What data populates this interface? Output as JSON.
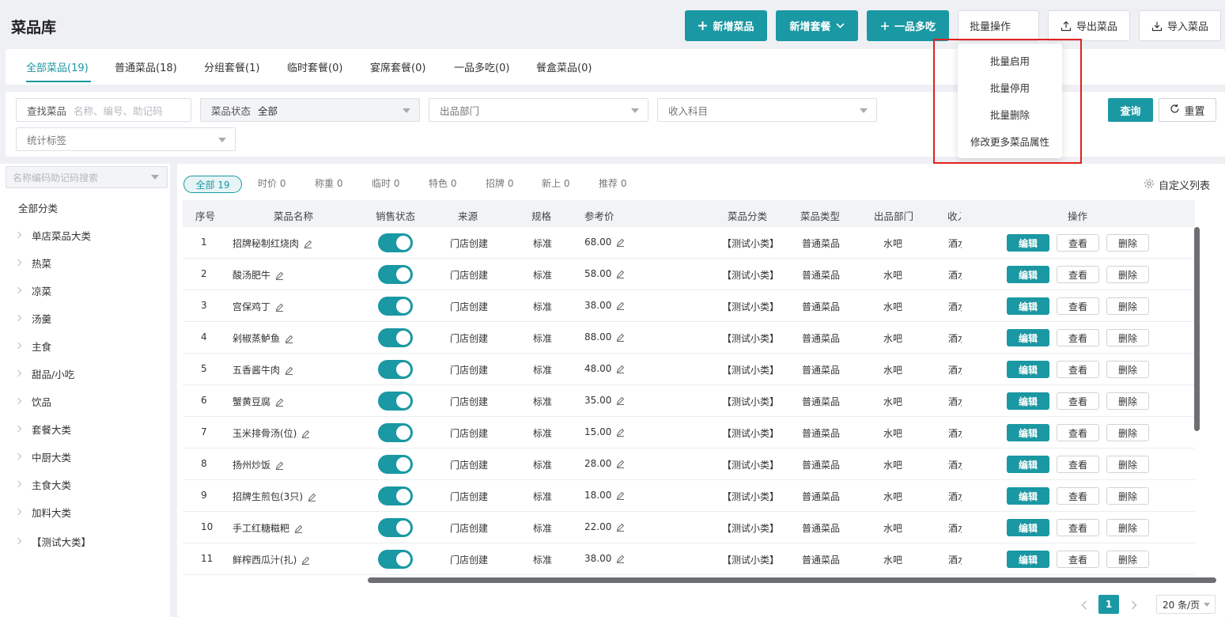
{
  "header": {
    "title": "菜品库",
    "buttons": {
      "add_dish": "新增菜品",
      "add_combo": "新增套餐",
      "one_dish_multi": "一品多吃",
      "batch_ops": "批量操作",
      "export": "导出菜品",
      "import": "导入菜品"
    }
  },
  "tabs": [
    {
      "label": "全部菜品(19)",
      "active": true
    },
    {
      "label": "普通菜品(18)"
    },
    {
      "label": "分组套餐(1)"
    },
    {
      "label": "临时套餐(0)"
    },
    {
      "label": "宴席套餐(0)"
    },
    {
      "label": "一品多吃(0)"
    },
    {
      "label": "餐盒菜品(0)"
    }
  ],
  "filters": {
    "search_label": "查找菜品",
    "search_placeholder": "名称、编号、助记码",
    "status_label": "菜品状态",
    "status_value": "全部",
    "dept_placeholder": "出品部门",
    "income_placeholder": "收入科目",
    "stat_tag_placeholder": "统计标签",
    "query": "查询",
    "reset": "重置"
  },
  "categories": {
    "search_placeholder": "名称编码助记码搜索",
    "all": "全部分类",
    "items": [
      "单店菜品大类",
      "热菜",
      "凉菜",
      "汤羹",
      "主食",
      "甜品/小吃",
      "饮品",
      "套餐大类",
      "中厨大类",
      "主食大类",
      "加料大类",
      "【测试大类】"
    ]
  },
  "chips": [
    "全部 19",
    "时价 0",
    "称重 0",
    "临时 0",
    "特色 0",
    "招牌 0",
    "新上 0",
    "推荐 0"
  ],
  "customize": "自定义列表",
  "table": {
    "headers": {
      "no": "序号",
      "name": "菜品名称",
      "status": "销售状态",
      "source": "来源",
      "spec": "规格",
      "price": "参考价",
      "category": "菜品分类",
      "type": "菜品类型",
      "dept": "出品部门",
      "income": "收入",
      "ops": "操作"
    },
    "btn_edit": "编辑",
    "btn_view": "查看",
    "btn_delete": "删除",
    "rows": [
      {
        "no": "1",
        "name": "招牌秘制红烧肉",
        "source": "门店创建",
        "spec": "标准",
        "price": "68.00",
        "category": "【测试小类】",
        "type": "普通菜品",
        "dept": "水吧",
        "income": "酒水",
        "on": true
      },
      {
        "no": "2",
        "name": "酸汤肥牛",
        "source": "门店创建",
        "spec": "标准",
        "price": "58.00",
        "category": "【测试小类】",
        "type": "普通菜品",
        "dept": "水吧",
        "income": "酒水",
        "on": true
      },
      {
        "no": "3",
        "name": "宫保鸡丁",
        "source": "门店创建",
        "spec": "标准",
        "price": "38.00",
        "category": "【测试小类】",
        "type": "普通菜品",
        "dept": "水吧",
        "income": "酒水",
        "on": true
      },
      {
        "no": "4",
        "name": "剁椒蒸鲈鱼",
        "source": "门店创建",
        "spec": "标准",
        "price": "88.00",
        "category": "【测试小类】",
        "type": "普通菜品",
        "dept": "水吧",
        "income": "酒水",
        "on": true
      },
      {
        "no": "5",
        "name": "五香酱牛肉",
        "source": "门店创建",
        "spec": "标准",
        "price": "48.00",
        "category": "【测试小类】",
        "type": "普通菜品",
        "dept": "水吧",
        "income": "酒水",
        "on": true
      },
      {
        "no": "6",
        "name": "蟹黄豆腐",
        "source": "门店创建",
        "spec": "标准",
        "price": "35.00",
        "category": "【测试小类】",
        "type": "普通菜品",
        "dept": "水吧",
        "income": "酒水",
        "on": true
      },
      {
        "no": "7",
        "name": "玉米排骨汤(位)",
        "source": "门店创建",
        "spec": "标准",
        "price": "15.00",
        "category": "【测试小类】",
        "type": "普通菜品",
        "dept": "水吧",
        "income": "酒水",
        "on": true
      },
      {
        "no": "8",
        "name": "扬州炒饭",
        "source": "门店创建",
        "spec": "标准",
        "price": "28.00",
        "category": "【测试小类】",
        "type": "普通菜品",
        "dept": "水吧",
        "income": "酒水",
        "on": true
      },
      {
        "no": "9",
        "name": "招牌生煎包(3只)",
        "source": "门店创建",
        "spec": "标准",
        "price": "18.00",
        "category": "【测试小类】",
        "type": "普通菜品",
        "dept": "水吧",
        "income": "酒水",
        "on": true
      },
      {
        "no": "10",
        "name": "手工红糖糍粑",
        "source": "门店创建",
        "spec": "标准",
        "price": "22.00",
        "category": "【测试小类】",
        "type": "普通菜品",
        "dept": "水吧",
        "income": "酒水",
        "on": true
      },
      {
        "no": "11",
        "name": "鲜榨西瓜汁(扎)",
        "source": "门店创建",
        "spec": "标准",
        "price": "38.00",
        "category": "【测试小类】",
        "type": "普通菜品",
        "dept": "水吧",
        "income": "酒水",
        "on": true
      }
    ]
  },
  "pager": {
    "current": "1",
    "page_size": "20 条/页"
  },
  "dropdown": [
    "批量启用",
    "批量停用",
    "批量删除",
    "修改更多菜品属性"
  ],
  "colors": {
    "accent": "#1a98a3",
    "highlight": "#e02020"
  }
}
